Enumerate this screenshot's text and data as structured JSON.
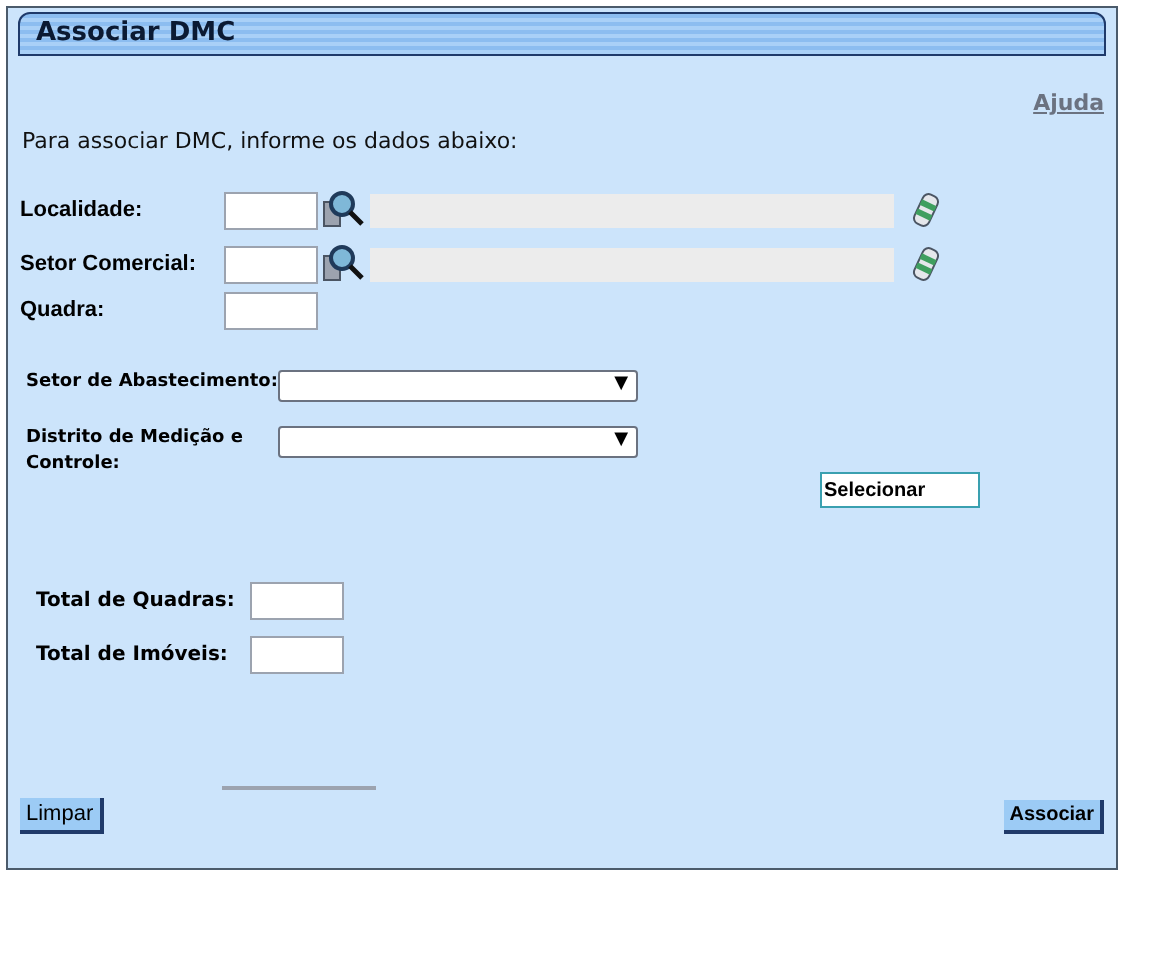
{
  "title": "Associar DMC",
  "help_link": "Ajuda",
  "intro": "Para associar DMC, informe os dados abaixo:",
  "lookup_fields": [
    {
      "label": "Localidade:"
    },
    {
      "label": "Setor Comercial:"
    }
  ],
  "quadra": {
    "label": "Quadra:"
  },
  "selects": [
    {
      "label": "Setor de Abastecimento:",
      "arrow": "▼"
    },
    {
      "label": "Distrito de Medição e Controle:",
      "arrow": "▼"
    }
  ],
  "select_button": "Selecionar",
  "totals": [
    {
      "label": "Total de Quadras:"
    },
    {
      "label": "Total de Imóveis:"
    }
  ],
  "buttons": {
    "clear": "Limpar",
    "submit": "Associar"
  }
}
